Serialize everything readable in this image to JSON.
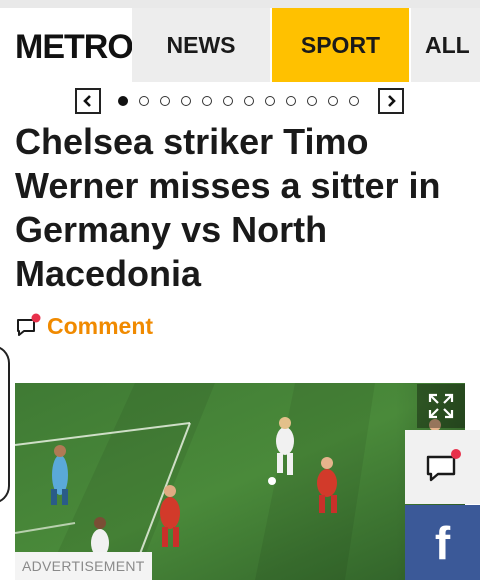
{
  "header": {
    "logo_text": "METRO",
    "tabs": [
      {
        "label": "NEWS",
        "active": false
      },
      {
        "label": "SPORT",
        "active": true
      },
      {
        "label": "ALL",
        "active": false
      }
    ],
    "colors": {
      "sport_accent": "#ffc100",
      "tab_bg": "#ededed"
    }
  },
  "carousel": {
    "prev_icon": "chevron-left-icon",
    "next_icon": "chevron-right-icon",
    "dot_count": 12,
    "active_index": 0
  },
  "article": {
    "headline": "Chelsea striker Timo Werner misses a sitter in Germany vs North Macedonia",
    "comment_label": "Comment",
    "comment_color": "#f08a00",
    "image_description_icon": "expand-icon"
  },
  "floating": {
    "chat_icon": "chat-bubble-icon",
    "facebook_icon": "facebook-icon",
    "facebook_letter": "f",
    "facebook_color": "#3b5998",
    "notification_color": "#e8314b"
  },
  "ad": {
    "label": "ADVERTISEMENT"
  }
}
